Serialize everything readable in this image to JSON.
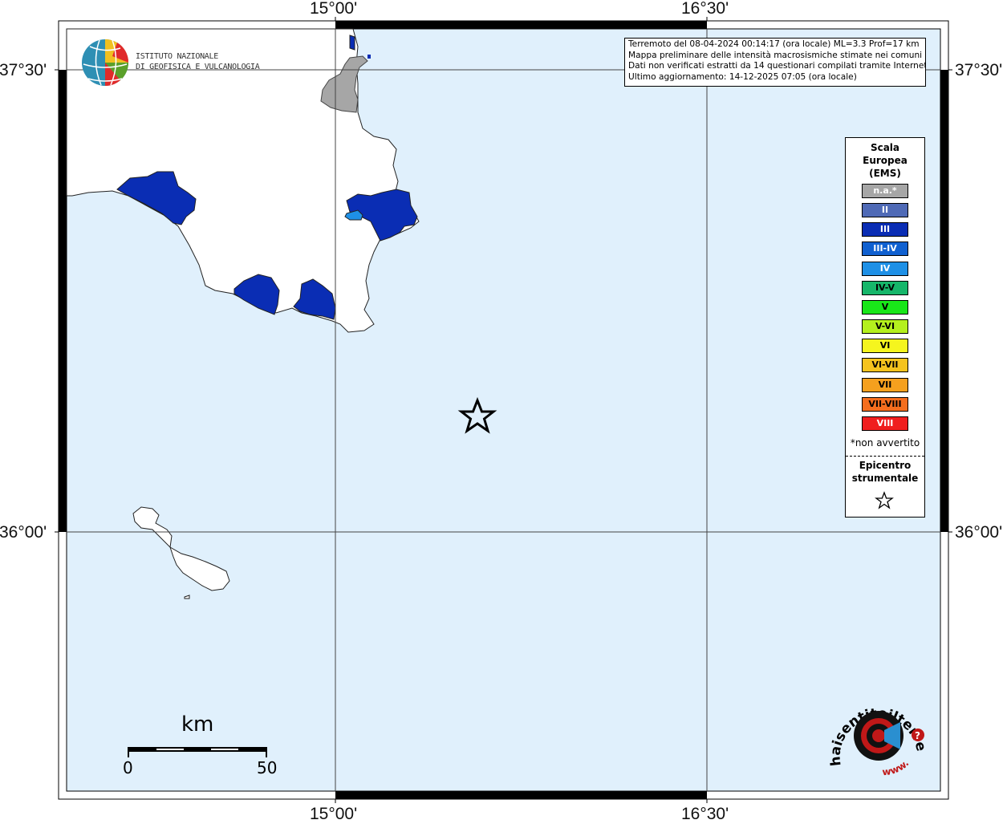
{
  "map": {
    "coordinates": {
      "top": [
        "15°00'",
        "16°30'"
      ],
      "bottom": [
        "15°00'",
        "16°30'"
      ],
      "left": [
        "37°30'",
        "36°00'"
      ],
      "right": [
        "37°30'",
        "36°00'"
      ]
    },
    "colors": {
      "sea": "#e0f0fc",
      "land": "#ffffff",
      "intensity_iii": "#0a2db4",
      "intensity_iv": "#1e90e6",
      "not_available": "#a6a6a6"
    }
  },
  "institute": {
    "name_line1": "ISTITUTO NAZIONALE",
    "name_line2": "DI GEOFISICA E VULCANOLOGIA"
  },
  "info": {
    "line1": "Terremoto del 08-04-2024 00:14:17 (ora locale) ML=3.3 Prof=17 km",
    "line2": "Mappa preliminare delle intensità macrosismiche stimate nei comuni",
    "line3": "Dati non verificati estratti da 14 questionari compilati tramite Internet.",
    "line4": "Ultimo aggiornamento: 14-12-2025 07:05 (ora locale)"
  },
  "legend": {
    "title_line1": "Scala",
    "title_line2": "Europea",
    "title_line3": "(EMS)",
    "items": [
      {
        "label": "n.a.*",
        "color": "#a6a6a6",
        "text_color": "#ffffff"
      },
      {
        "label": "II",
        "color": "#4f6ab6",
        "text_color": "#ffffff"
      },
      {
        "label": "III",
        "color": "#0a2db4",
        "text_color": "#ffffff"
      },
      {
        "label": "III-IV",
        "color": "#1060d0",
        "text_color": "#ffffff"
      },
      {
        "label": "IV",
        "color": "#1e90e6",
        "text_color": "#ffffff"
      },
      {
        "label": "IV-V",
        "color": "#16b66a",
        "text_color": "#000000"
      },
      {
        "label": "V",
        "color": "#19e619",
        "text_color": "#000000"
      },
      {
        "label": "V-VI",
        "color": "#b4f01e",
        "text_color": "#000000"
      },
      {
        "label": "VI",
        "color": "#f5f51e",
        "text_color": "#000000"
      },
      {
        "label": "VI-VII",
        "color": "#f5c31e",
        "text_color": "#000000"
      },
      {
        "label": "VII",
        "color": "#f5a01e",
        "text_color": "#000000"
      },
      {
        "label": "VII-VIII",
        "color": "#f56e1e",
        "text_color": "#000000"
      },
      {
        "label": "VIII",
        "color": "#f01e1e",
        "text_color": "#ffffff"
      }
    ],
    "note": "*non avvertito",
    "epicenter_line1": "Epicentro",
    "epicenter_line2": "strumentale"
  },
  "scale": {
    "unit": "km",
    "start": "0",
    "end": "50"
  },
  "logo_text": {
    "arc": "haisentitoilterremoto.it",
    "bottom": "www."
  }
}
